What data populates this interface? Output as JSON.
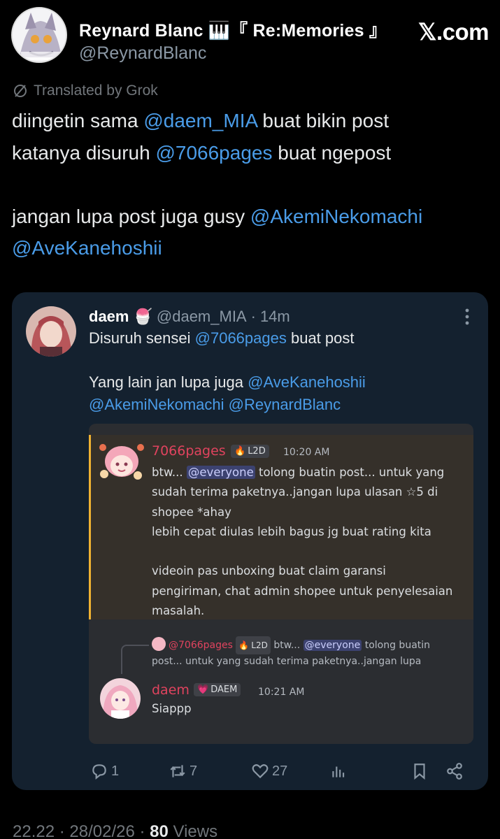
{
  "post": {
    "author_name": "Reynard Blanc",
    "author_emoji": "🎹『 Re:Memories 』",
    "author_handle": "@ReynardBlanc",
    "site_logo": "𝕏.com",
    "translated_label": "Translated by Grok",
    "text_lines": [
      [
        {
          "t": "diingetin sama "
        },
        {
          "m": "@daem_MIA"
        },
        {
          "t": " buat bikin post"
        }
      ],
      [
        {
          "t": "katanya disuruh "
        },
        {
          "m": "@7066pages"
        },
        {
          "t": " buat ngepost"
        }
      ],
      [],
      [
        {
          "t": "jangan lupa post juga gusy "
        },
        {
          "m": "@AkemiNekomachi"
        }
      ],
      [
        {
          "m": "@AveKanehoshii"
        }
      ]
    ],
    "footer": {
      "time": "22.22",
      "date": "28/02/26",
      "views_count": "80",
      "views_label": "Views"
    }
  },
  "quote": {
    "author_name": "daem",
    "author_emoji": "🍧",
    "author_handle": "@daem_MIA",
    "separator": "·",
    "time": "14m",
    "text_lines": [
      [
        {
          "t": "Disuruh sensei "
        },
        {
          "m": "@7066pages"
        },
        {
          "t": " buat post"
        }
      ],
      [],
      [
        {
          "t": "Yang lain jan lupa juga "
        },
        {
          "m": "@AveKanehoshii"
        }
      ],
      [
        {
          "m": "@AkemiNekomachi"
        },
        {
          "t": " "
        },
        {
          "m": "@ReynardBlanc"
        }
      ]
    ],
    "stats": {
      "replies": "1",
      "reposts": "7",
      "likes": "27"
    }
  },
  "discord": {
    "msg1": {
      "name": "7066pages",
      "badge": "L2D",
      "time": "10:20 AM",
      "lines": [
        [
          {
            "t": "btw... "
          },
          {
            "p": "@everyone"
          },
          {
            "t": "  tolong buatin post... untuk yang"
          }
        ],
        [
          {
            "t": "sudah terima paketnya..jangan lupa ulasan ☆5 di"
          }
        ],
        [
          {
            "t": "shopee *ahay"
          }
        ],
        [
          {
            "t": "lebih cepat diulas lebih bagus jg buat rating kita"
          }
        ],
        [],
        [
          {
            "t": " videoin pas unboxing buat claim garansi"
          }
        ],
        [
          {
            "t": "pengiriman, chat admin shopee untuk penyelesaian"
          }
        ],
        [
          {
            "t": "masalah."
          }
        ]
      ]
    },
    "reply_preview": {
      "name": "@7066pages",
      "badge": "L2D",
      "pre": "btw... ",
      "ping": "@everyone",
      "post": " tolong buatin",
      "line2": "post... untuk yang sudah terima paketnya..jangan lupa"
    },
    "msg2": {
      "name": "daem",
      "badge": "DAEM",
      "time": "10:21 AM",
      "text": "Siappp"
    }
  },
  "colors": {
    "mention": "#4a9ce8",
    "card_bg": "#14212f",
    "discord_bg": "#2b2d31",
    "discord_name": "#e0435e",
    "highlight_bar": "#f0b232"
  }
}
